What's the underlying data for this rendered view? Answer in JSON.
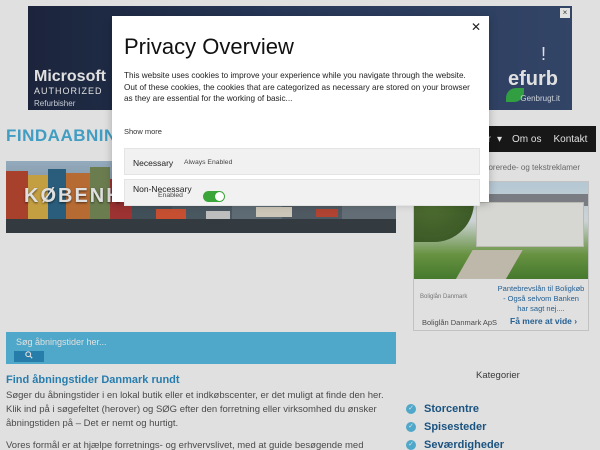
{
  "top_ad": {
    "brand": "Microsoft",
    "authorized": "AUTHORIZED",
    "refurbisher": "Refurbisher",
    "dash": "-",
    "excl": "!",
    "refurb": "efurb",
    "genbrugt": "Genbrugt.it"
  },
  "site": {
    "title": "FINDAABNING",
    "nav": [
      "rter",
      "▾",
      "Om os",
      "Kontakt"
    ]
  },
  "hero": {
    "caption": "KØBENH"
  },
  "search": {
    "placeholder": "Søg åbningstider her..."
  },
  "main": {
    "heading": "Find åbningstider Danmark rundt",
    "paragraph": "Søger du åbningstider i en lokal butik eller et indkøbscenter, er det muligt at finde den her. Klik ind på i søgefeltet (herover) og SØG efter den forretning eller virksomhed du ønsker åbningstiden på – Det er nemt og hurtigt.",
    "paragraph2": "Vores formål er at hjælpe forretnings- og erhvervslivet, med at guide besøgende med"
  },
  "sidebar": {
    "ad_label": "nsorerede- og tekstreklamer",
    "ad": {
      "logo": "Boliglån Danmark",
      "text": "Pantebrevslån til Boligkøb - Også selvom Banken har sagt nej....",
      "advertiser": "Boliglån Danmark ApS",
      "more": "Få mere at vide",
      "more_arrow": "›"
    },
    "categories_title": "Kategorier",
    "categories": [
      "Storcentre",
      "Spisesteder",
      "Seværdigheder"
    ]
  },
  "modal": {
    "title": "Privacy Overview",
    "close": "✕",
    "description": "This website uses cookies to improve your experience while you navigate through the website. Out of these cookies, the cookies that are categorized as necessary are stored on your browser as they are essential for the working of basic...",
    "show_more": "Show more",
    "rows": [
      {
        "label": "Necessary",
        "status": "Always Enabled"
      },
      {
        "label": "Non-Necessary",
        "status": "Enabled",
        "enabled": true
      }
    ]
  },
  "colors": {
    "accent": "#5bc0e5",
    "title": "#4ab3dd",
    "toggle_on": "#3aa63a"
  }
}
